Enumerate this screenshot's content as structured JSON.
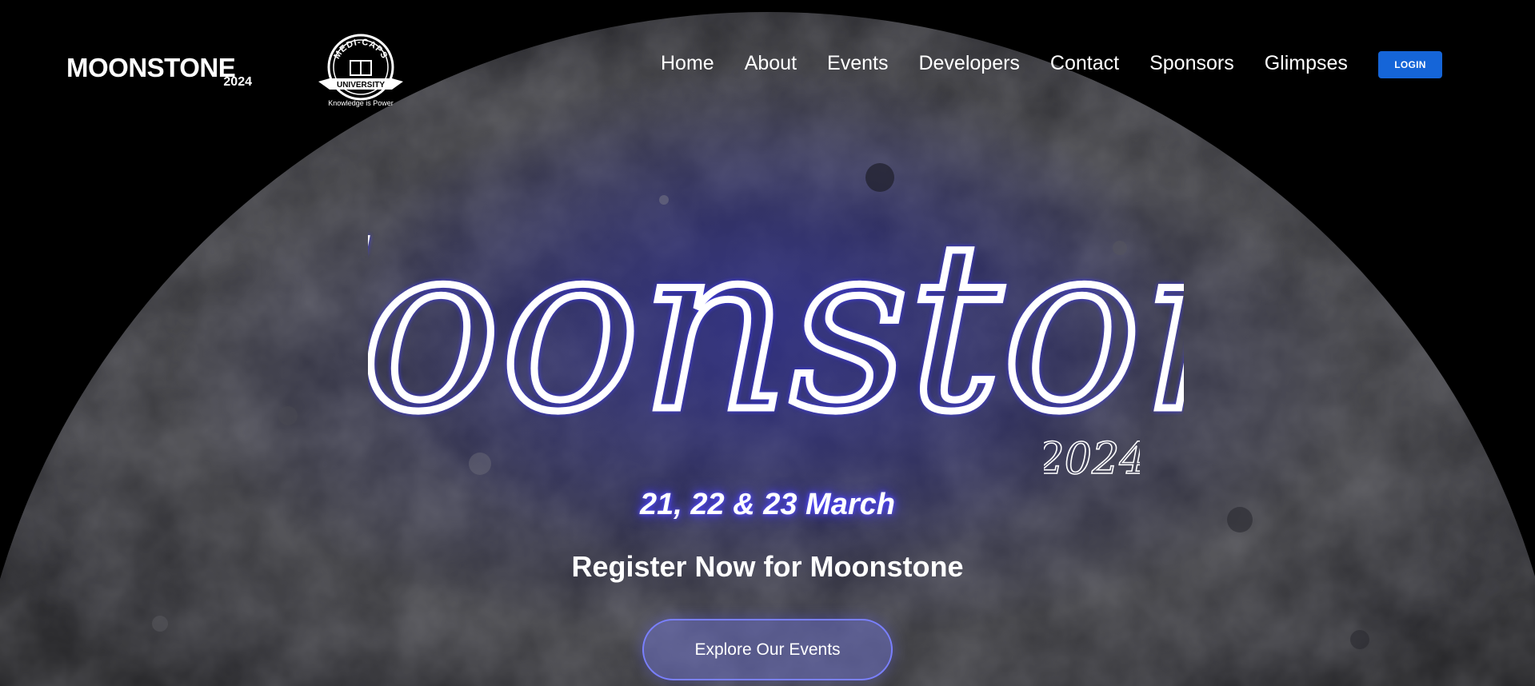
{
  "brand": {
    "logo_text": "MOONSTONE",
    "logo_year": "2024"
  },
  "university": {
    "name": "MEDI-CAPS",
    "banner": "UNIVERSITY",
    "tagline": "Knowledge is Power"
  },
  "nav": {
    "items": [
      {
        "label": "Home"
      },
      {
        "label": "About"
      },
      {
        "label": "Events"
      },
      {
        "label": "Developers"
      },
      {
        "label": "Contact"
      },
      {
        "label": "Sponsors"
      },
      {
        "label": "Glimpses"
      }
    ],
    "login_label": "LOGIN"
  },
  "hero": {
    "title": "Moonstone",
    "year": "2024",
    "date": "21, 22 & 23 March",
    "register_text": "Register Now for Moonstone",
    "cta_label": "Explore Our Events"
  },
  "colors": {
    "accent_blue": "#1565d8",
    "glow": "#4b43ff",
    "button_border": "#7a80ff"
  }
}
